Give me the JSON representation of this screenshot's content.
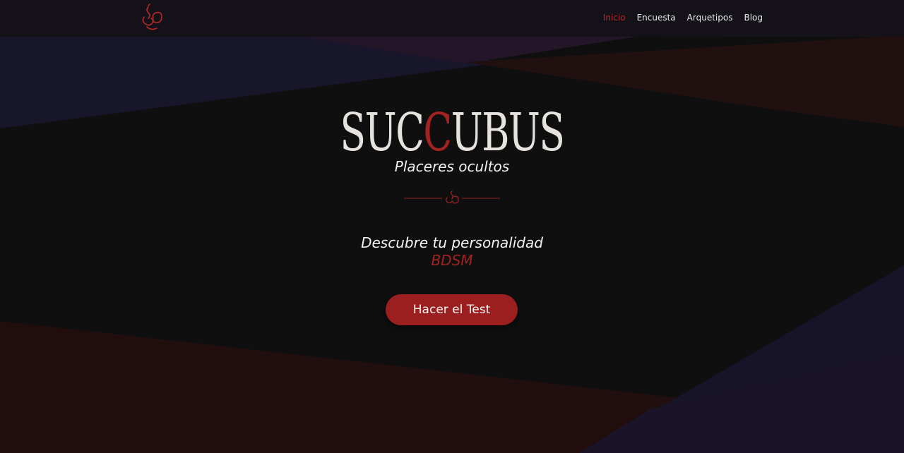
{
  "nav": {
    "items": [
      {
        "label": "Inicio",
        "active": true
      },
      {
        "label": "Encuesta",
        "active": false
      },
      {
        "label": "Arquetipos",
        "active": false
      },
      {
        "label": "Blog",
        "active": false
      }
    ]
  },
  "hero": {
    "brand_before": "SUC",
    "brand_accent": "C",
    "brand_after": "UBUS",
    "tagline": "Placeres ocultos",
    "headline": "Descubre tu personalidad",
    "headline_accent": "BDSM",
    "cta_label": "Hacer el Test"
  },
  "colors": {
    "accent": "#a32222",
    "background": "#0f0f0f",
    "text": "#f2f2f2"
  },
  "icons": {
    "logo": "succubus-logo-icon",
    "divider": "ornament-divider-icon"
  }
}
